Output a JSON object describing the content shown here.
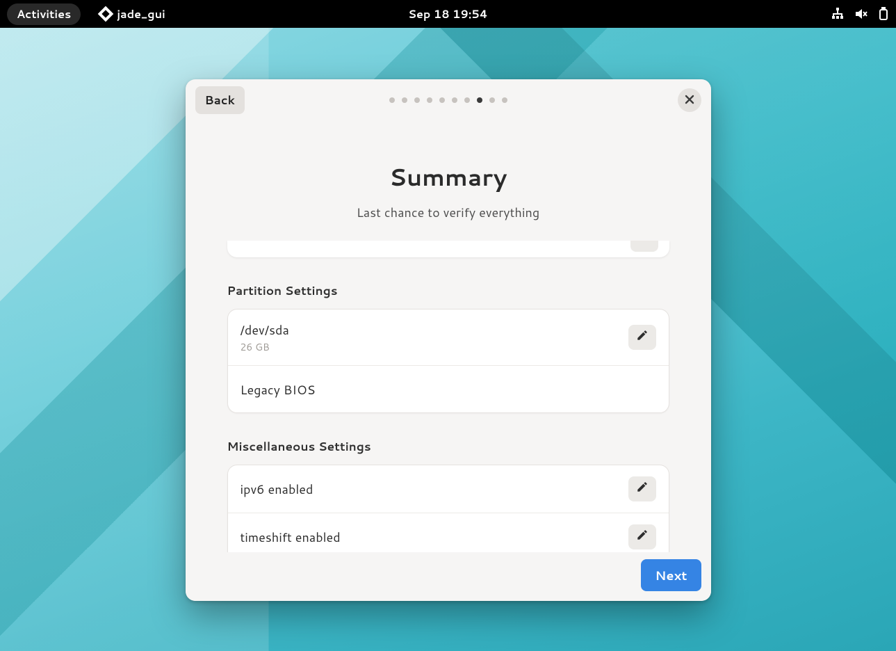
{
  "panel": {
    "activities_label": "Activities",
    "app_name": "jade_gui",
    "clock": "Sep 18  19:54"
  },
  "dialog": {
    "back_label": "Back",
    "close_aria": "Close",
    "pager": {
      "total": 10,
      "active_index": 7
    },
    "title": "Summary",
    "subtitle": "Last chance to verify everything",
    "next_label": "Next",
    "sections": {
      "partition": {
        "label": "Partition Settings",
        "device": "/dev/sda",
        "device_size": "26 GB",
        "boot_mode": "Legacy BIOS"
      },
      "misc": {
        "label": "Miscellaneous Settings",
        "ipv6": "ipv6 enabled",
        "timeshift": "timeshift enabled"
      }
    }
  }
}
